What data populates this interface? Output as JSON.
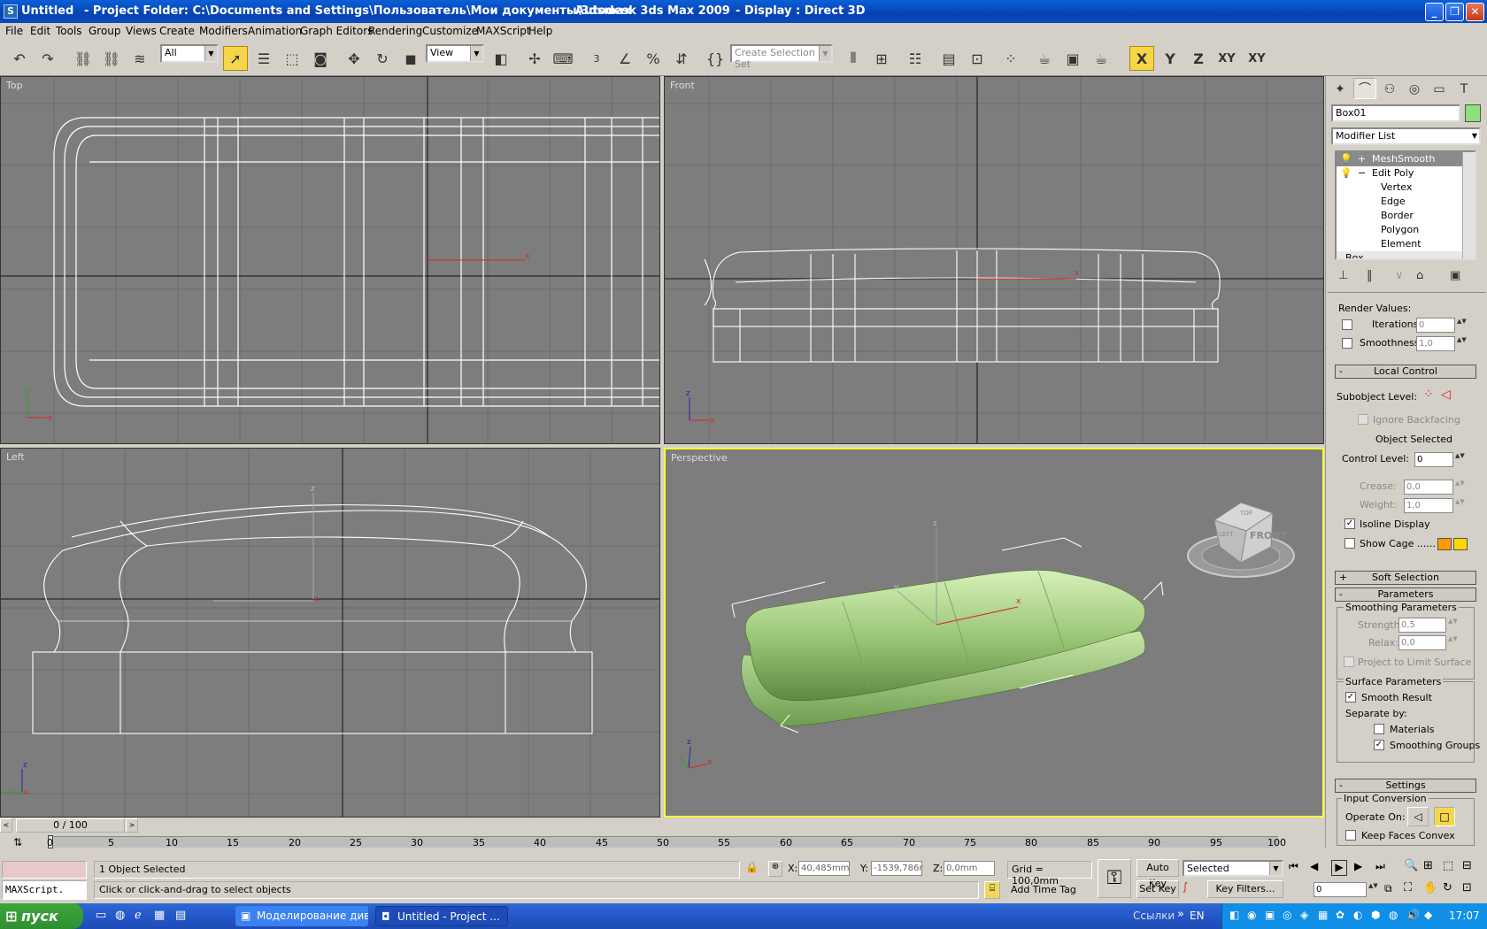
{
  "window": {
    "title_left": "Untitled",
    "project": "- Project Folder: C:\\Documents and Settings\\Пользователь\\Мои документы\\3dsmax",
    "app": "- Autodesk 3ds Max  2009",
    "display": "- Display : Direct 3D"
  },
  "menu": [
    "File",
    "Edit",
    "Tools",
    "Group",
    "Views",
    "Create",
    "Modifiers",
    "Animation",
    "Graph Editors",
    "Rendering",
    "Customize",
    "MAXScript",
    "Help"
  ],
  "toolbar": {
    "filter_value": "All",
    "refcoord_value": "View",
    "selection_set_placeholder": "Create Selection Set",
    "snap_label": "3",
    "axes": [
      "X",
      "Y",
      "Z",
      "XY",
      "XY"
    ]
  },
  "viewports": {
    "top": "Top",
    "front": "Front",
    "left": "Left",
    "perspective": "Perspective"
  },
  "viewcube": {
    "face": "FRONT",
    "top": "TOP",
    "side": "LEFT"
  },
  "command_panel": {
    "object_name": "Box01",
    "color": "#8ee07a",
    "modifier_list": "Modifier List",
    "stack": [
      {
        "label": "MeshSmooth",
        "toggle": "+"
      },
      {
        "label": "Edit Poly",
        "toggle": "−"
      },
      {
        "label": "Vertex"
      },
      {
        "label": "Edge"
      },
      {
        "label": "Border"
      },
      {
        "label": "Polygon"
      },
      {
        "label": "Element"
      },
      {
        "label": "Box"
      }
    ],
    "render_values": "Render Values:",
    "iterations_label": "Iterations:",
    "iterations_value": "0",
    "smoothness_label": "Smoothness:",
    "smoothness_value": "1,0",
    "local_control": "Local Control",
    "subobject_level": "Subobject Level:",
    "ignore_backfacing": "Ignore Backfacing",
    "object_selected": "Object Selected",
    "control_level_label": "Control Level:",
    "control_level_value": "0",
    "crease_label": "Crease:",
    "crease_value": "0,0",
    "weight_label": "Weight:",
    "weight_value": "1,0",
    "isoline_display": "Isoline Display",
    "show_cage": "Show Cage ......",
    "cage_colors": [
      "#ff9900",
      "#ffd700"
    ],
    "soft_selection": "Soft Selection",
    "parameters": "Parameters",
    "smoothing_parameters": "Smoothing Parameters",
    "strength_label": "Strength:",
    "strength_value": "0,5",
    "relax_label": "Relax:",
    "relax_value": "0,0",
    "project_limit": "Project to Limit Surface",
    "surface_parameters": "Surface Parameters",
    "smooth_result": "Smooth Result",
    "separate_by": "Separate by:",
    "materials": "Materials",
    "smoothing_groups": "Smoothing Groups",
    "settings": "Settings",
    "input_conversion": "Input Conversion",
    "operate_on": "Operate On:",
    "keep_faces_convex": "Keep Faces Convex"
  },
  "timeline": {
    "slider": "0 / 100",
    "ticks": [
      "0",
      "5",
      "10",
      "15",
      "20",
      "25",
      "30",
      "35",
      "40",
      "45",
      "50",
      "55",
      "60",
      "65",
      "70",
      "75",
      "80",
      "85",
      "90",
      "95",
      "100"
    ]
  },
  "status": {
    "maxscript": "MAXScript.",
    "selected_count": "1 Object Selected",
    "prompt": "Click or click-and-drag to select objects",
    "x_label": "X:",
    "x_value": "40,485mm",
    "y_label": "Y:",
    "y_value": "-1539,786r",
    "z_label": "Z:",
    "z_value": "0,0mm",
    "grid": "Grid = 100,0mm",
    "add_time_tag": "Add Time Tag",
    "auto_key": "Auto Key",
    "set_key": "Set Key",
    "selected_dropdown": "Selected",
    "key_filters": "Key Filters...",
    "frame": "0"
  },
  "taskbar": {
    "start": "пуск",
    "tasks": [
      "Моделирование див...",
      "Untitled      - Project ..."
    ],
    "links": "Ссылки",
    "lang": "EN",
    "time": "17:07"
  }
}
